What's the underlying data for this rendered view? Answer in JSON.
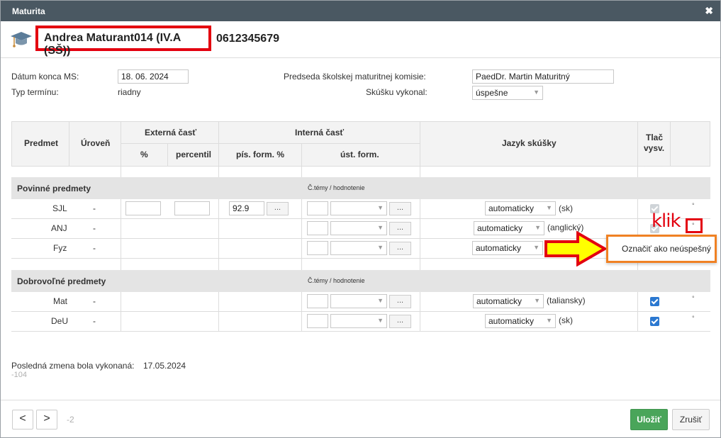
{
  "dialog": {
    "title": "Maturita",
    "close_glyph": "✖"
  },
  "student": {
    "name": "Andrea Maturant014 (IV.A (SŠ))",
    "id": "0612345679",
    "icon": "graduation-cap-icon"
  },
  "form": {
    "end_date_label": "Dátum konca MS:",
    "end_date_value": "18. 06. 2024",
    "term_type_label": "Typ termínu:",
    "term_type_value": "riadny",
    "chair_label": "Predseda školskej maturitnej komisie:",
    "chair_value": "PaedDr. Martin Maturitný",
    "result_label": "Skúšku vykonal:",
    "result_value": "úspešne"
  },
  "table": {
    "col_subject": "Predmet",
    "col_level": "Úroveň",
    "col_external": "Externá časť",
    "col_percent": "%",
    "col_percentile": "percentil",
    "col_internal": "Interná časť",
    "col_written": "pís. form. %",
    "col_oral": "úst. form.",
    "col_language": "Jazyk skúšky",
    "col_print_1": "Tlač",
    "col_print_2": "vysv.",
    "topics_hint": "Č.témy / hodnotenie",
    "dots": "...",
    "degree": "°"
  },
  "compulsory": {
    "title": "Povinné predmety",
    "rows": [
      {
        "subject": "SJL",
        "level": "-",
        "written": "92.9",
        "language": "automaticky",
        "lang_note": "(sk)"
      },
      {
        "subject": "ANJ",
        "level": "-",
        "language": "automaticky",
        "lang_note": "(anglický)"
      },
      {
        "subject": "Fyz",
        "level": "-",
        "language": "automaticky",
        "lang_note": ""
      }
    ]
  },
  "optional": {
    "title": "Dobrovoľné predmety",
    "rows": [
      {
        "subject": "Mat",
        "level": "-",
        "language": "automaticky",
        "lang_note": "(taliansky)"
      },
      {
        "subject": "DeU",
        "level": "-",
        "language": "automaticky",
        "lang_note": "(sk)"
      }
    ]
  },
  "annotation": {
    "klik": "klik",
    "popup": "Označiť ako neúspešný"
  },
  "footer": {
    "last_change_label": "Posledná zmena bola vykonaná:",
    "last_change_value": "17.05.2024",
    "code": "-104",
    "prev": "<",
    "next": ">",
    "page": "-2",
    "save": "Uložiť",
    "cancel": "Zrušiť"
  },
  "colors": {
    "titlebar": "#4a5862",
    "highlight": "#e3000f",
    "popup_border": "#f08123",
    "arrow": "#ffff00",
    "save": "#4aa55a",
    "checkbox": "#2b78d0"
  }
}
